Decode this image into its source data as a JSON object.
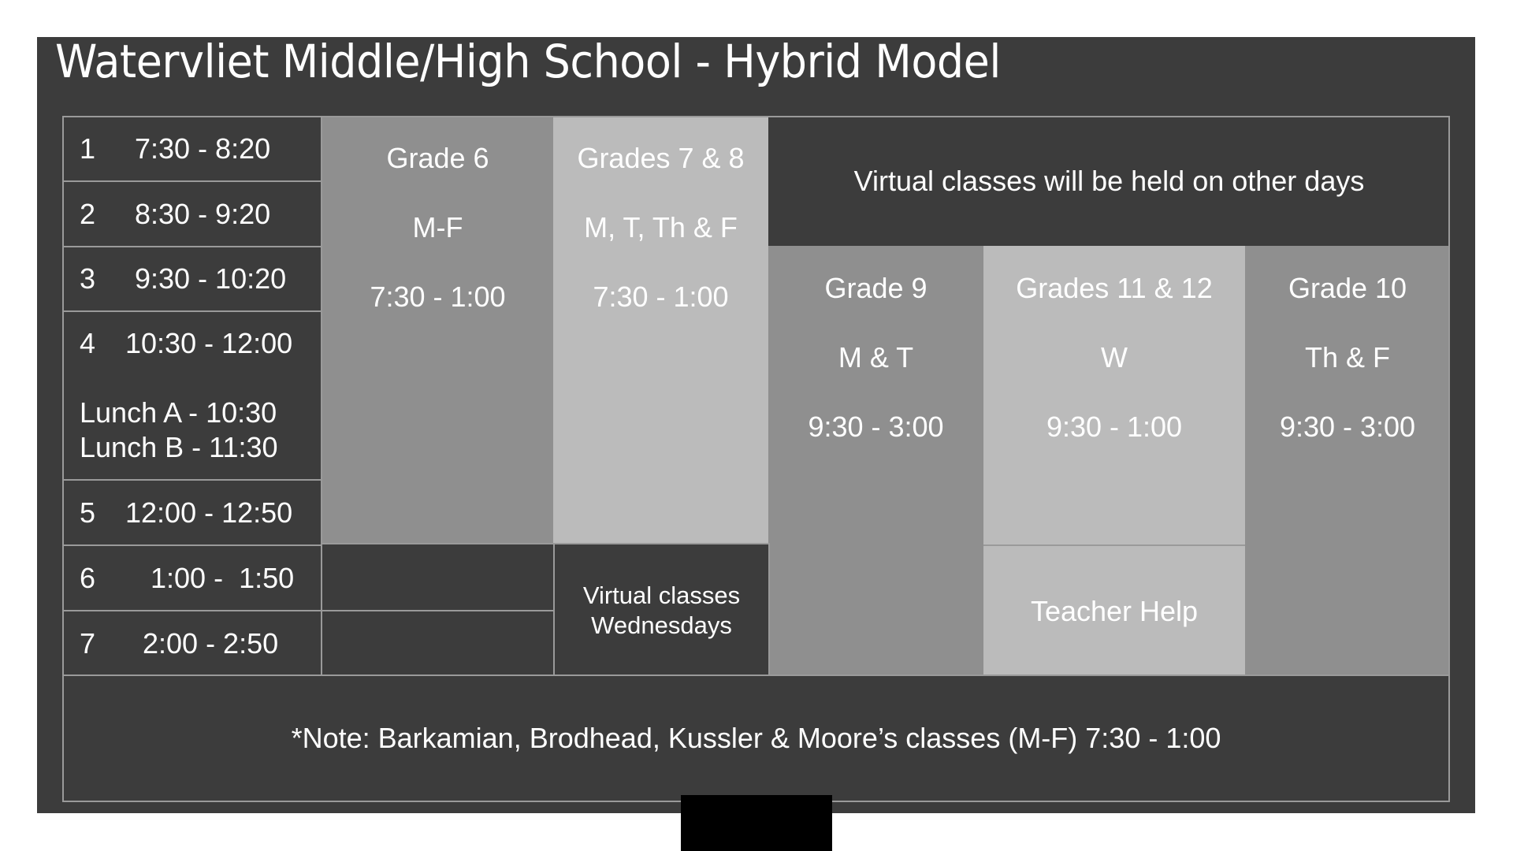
{
  "title": "Watervliet Middle/High School - Hybrid Model",
  "periods": [
    {
      "num": "1",
      "time": "7:30 - 8:20"
    },
    {
      "num": "2",
      "time": "8:30 - 9:20"
    },
    {
      "num": "3",
      "time": "9:30 - 10:20"
    },
    {
      "num": "4",
      "time": "10:30 - 12:00",
      "lunch": [
        "Lunch A - 10:30",
        "Lunch B - 11:30"
      ]
    },
    {
      "num": "5",
      "time": "12:00 - 12:50"
    },
    {
      "num": "6",
      "time": "  1:00 -  1:50"
    },
    {
      "num": "7",
      "time": " 2:00 - 2:50"
    }
  ],
  "grades": {
    "grade6": {
      "label": "Grade 6",
      "days": "M-F",
      "hours": "7:30 - 1:00"
    },
    "grades78": {
      "label": "Grades 7 & 8",
      "days": "M, T, Th & F",
      "hours": "7:30 - 1:00"
    },
    "grade9": {
      "label": "Grade 9",
      "days": "M & T",
      "hours": "9:30 - 3:00"
    },
    "grades1112": {
      "label": "Grades 11 & 12",
      "days": "W",
      "hours": "9:30 - 1:00"
    },
    "grade10": {
      "label": "Grade 10",
      "days": "Th & F",
      "hours": "9:30 - 3:00"
    }
  },
  "virtual_header": "Virtual classes will be held on other days",
  "virtual_wednesdays": [
    "Virtual classes",
    "Wednesdays"
  ],
  "teacher_help": "Teacher Help",
  "note": "*Note: Barkamian, Brodhead, Kussler & Moore’s classes (M-F) 7:30 - 1:00",
  "colors": {
    "background": "#3c3c3c",
    "mid_gray": "#8f8f8f",
    "light_gray": "#bbbbbb",
    "border": "#9a9a9a",
    "text": "#ffffff"
  }
}
